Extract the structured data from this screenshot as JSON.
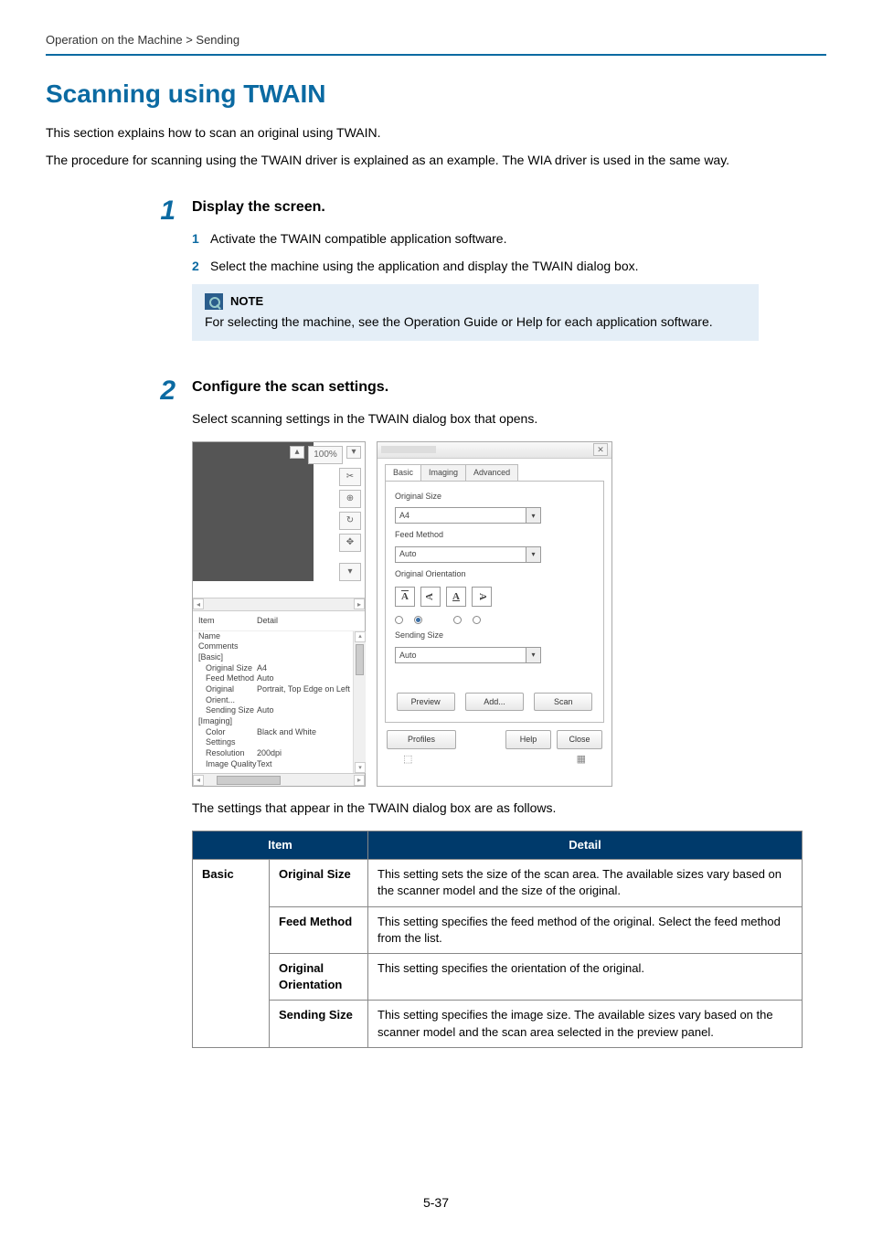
{
  "breadcrumb": "Operation on the Machine > Sending",
  "title": "Scanning using TWAIN",
  "intro_1": "This section explains how to scan an original using TWAIN.",
  "intro_2": "The procedure for scanning using the TWAIN driver is explained as an example. The WIA driver is used in the same way.",
  "step1": {
    "num": "1",
    "heading": "Display the screen.",
    "sub1_num": "1",
    "sub1_text": "Activate the TWAIN compatible application software.",
    "sub2_num": "2",
    "sub2_text": "Select the machine using the application and display the TWAIN dialog box.",
    "note_title": "NOTE",
    "note_body": "For selecting the machine, see the Operation Guide or Help for each application software."
  },
  "step2": {
    "num": "2",
    "heading": "Configure the scan settings.",
    "intro": "Select scanning settings in the TWAIN dialog box that opens.",
    "after": "The settings that appear in the TWAIN dialog box are as follows."
  },
  "shot": {
    "zoom": "100%",
    "left_cols": {
      "c1": "Item",
      "c2": "Detail"
    },
    "rows": {
      "name": "Name",
      "comments": "Comments",
      "basic": "[Basic]",
      "orig_size_k": "Original Size",
      "orig_size_v": "A4",
      "feed_k": "Feed Method",
      "feed_v": "Auto",
      "orient_k": "Original Orient...",
      "orient_v": "Portrait, Top Edge on Left",
      "send_k": "Sending Size",
      "send_v": "Auto",
      "imaging": "[Imaging]",
      "color_k": "Color Settings",
      "color_v": "Black and White",
      "res_k": "Resolution",
      "res_v": "200dpi",
      "iq_k": "Image Quality",
      "iq_v": "Text"
    },
    "tabs": {
      "basic": "Basic",
      "imaging": "Imaging",
      "advanced": "Advanced"
    },
    "fields": {
      "orig_size_label": "Original Size",
      "orig_size_val": "A4",
      "feed_label": "Feed Method",
      "feed_val": "Auto",
      "orient_label": "Original Orientation",
      "sending_label": "Sending Size",
      "sending_val": "Auto"
    },
    "orient_glyphs": {
      "a": "A",
      "b": "A",
      "c": "A",
      "d": "A"
    },
    "buttons": {
      "preview": "Preview",
      "add": "Add...",
      "scan": "Scan",
      "profiles": "Profiles",
      "help": "Help",
      "close": "Close"
    }
  },
  "table": {
    "h_item": "Item",
    "h_detail": "Detail",
    "cat_basic": "Basic",
    "r1_sub": "Original Size",
    "r1_det": "This setting sets the size of the scan area. The available sizes vary based on the scanner model and the size of the original.",
    "r2_sub": "Feed Method",
    "r2_det": "This setting specifies the feed method of the original. Select the feed method from the list.",
    "r3_sub": "Original Orientation",
    "r3_det": "This setting specifies the orientation of the original.",
    "r4_sub": "Sending Size",
    "r4_det": "This setting specifies the image size. The available sizes vary based on the scanner model and the scan area selected in the preview panel."
  },
  "page_number": "5-37"
}
